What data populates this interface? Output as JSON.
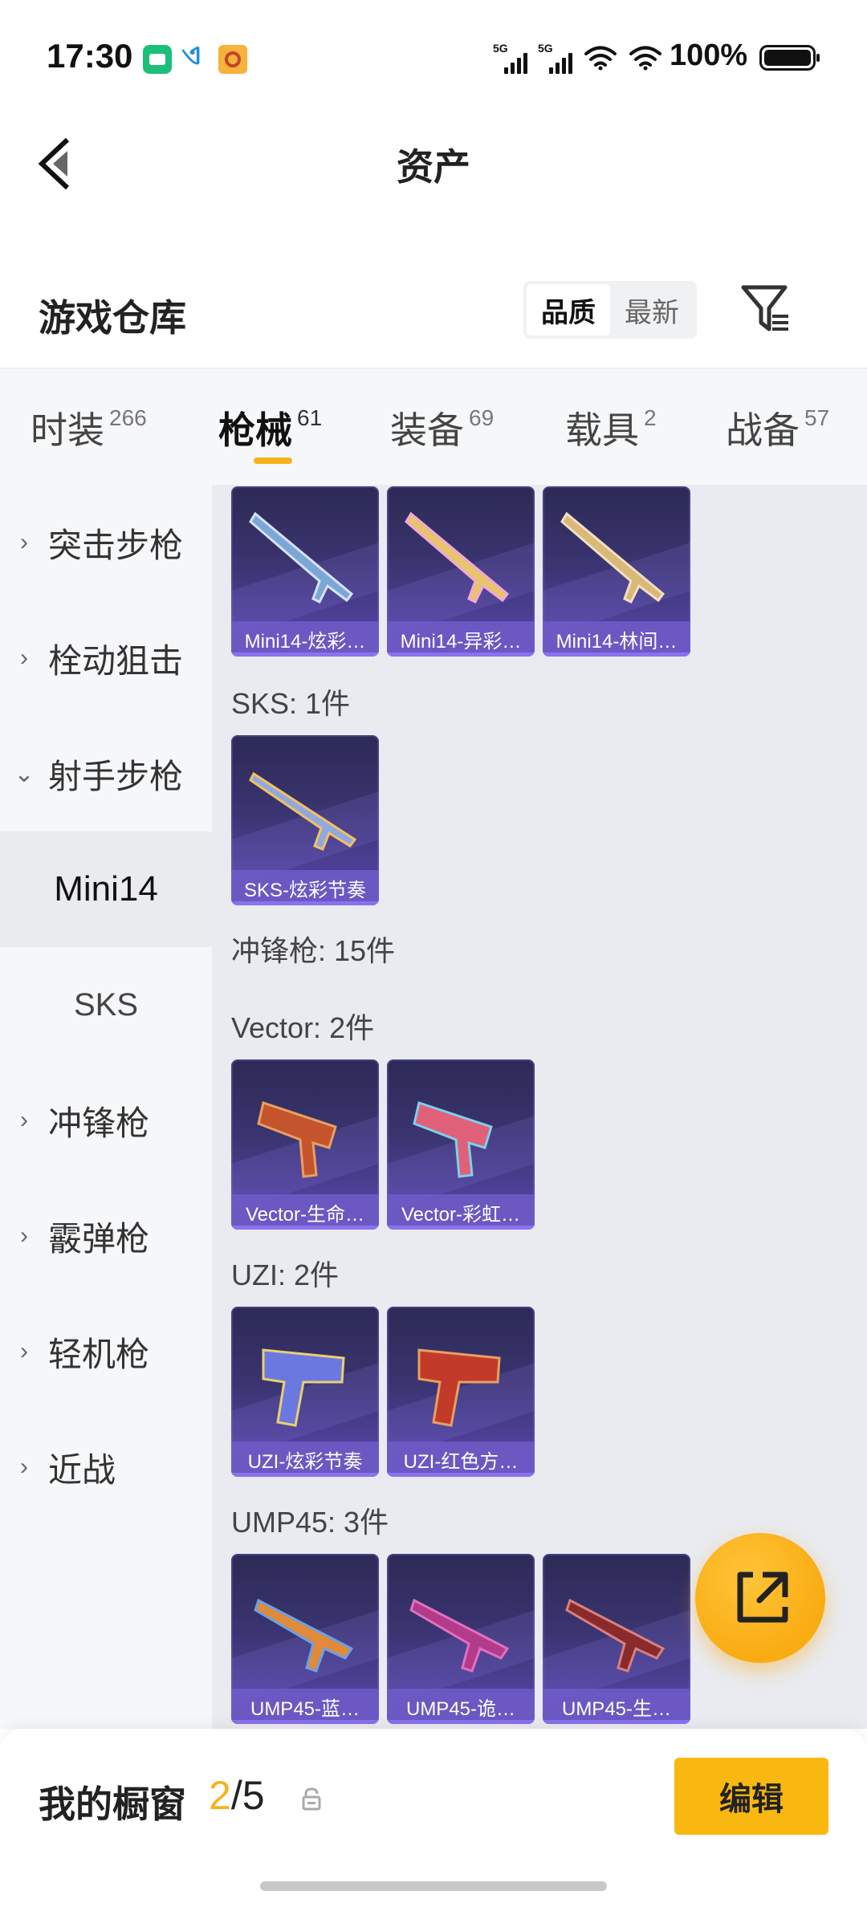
{
  "status_bar": {
    "time": "17:30",
    "signal_label": "5G",
    "battery": "100%",
    "icons": [
      "app-notification-icon",
      "telecom-icon",
      "game-notification-icon",
      "signal-icon",
      "signal-icon",
      "wifi-icon",
      "wifi-icon",
      "battery-icon"
    ]
  },
  "header": {
    "title": "资产"
  },
  "warehouse": {
    "title": "游戏仓库",
    "sort_options": [
      "品质",
      "最新"
    ],
    "active_sort": "品质"
  },
  "tabs": [
    {
      "label": "时装",
      "count": "266"
    },
    {
      "label": "枪械",
      "count": "61",
      "active": true
    },
    {
      "label": "装备",
      "count": "69"
    },
    {
      "label": "载具",
      "count": "2"
    },
    {
      "label": "战备",
      "count": "57"
    }
  ],
  "sidebar": [
    {
      "label": "突击步枪",
      "expanded": false
    },
    {
      "label": "栓动狙击",
      "expanded": false
    },
    {
      "label": "射手步枪",
      "expanded": true
    },
    {
      "label": "Mini14",
      "sub": true,
      "active": true
    },
    {
      "label": "SKS",
      "sub": true
    },
    {
      "label": "冲锋枪",
      "expanded": false
    },
    {
      "label": "霰弹枪",
      "expanded": false
    },
    {
      "label": "轻机枪",
      "expanded": false
    },
    {
      "label": "近战",
      "expanded": false
    }
  ],
  "content": {
    "groups": [
      {
        "label": "",
        "items": [
          "Mini14-炫彩…",
          "Mini14-异彩…",
          "Mini14-林间…"
        ]
      },
      {
        "label": "SKS: 1件",
        "items": [
          "SKS-炫彩节奏"
        ]
      },
      {
        "label": "冲锋枪: 15件",
        "items": []
      },
      {
        "label": "Vector: 2件",
        "items": [
          "Vector-生命…",
          "Vector-彩虹…"
        ]
      },
      {
        "label": "UZI: 2件",
        "items": [
          "UZI-炫彩节奏",
          "UZI-红色方…"
        ]
      },
      {
        "label": "UMP45: 3件",
        "items": [
          "UMP45-蓝…",
          "UMP45-诡…",
          "UMP45-生…"
        ]
      }
    ]
  },
  "bottom": {
    "showcase_label": "我的橱窗",
    "showcase_current": "2",
    "showcase_total": "/5",
    "edit_label": "编辑"
  },
  "colors": {
    "accent": "#f7b21e",
    "card": "#3a3470",
    "card_label": "#705cc8"
  }
}
